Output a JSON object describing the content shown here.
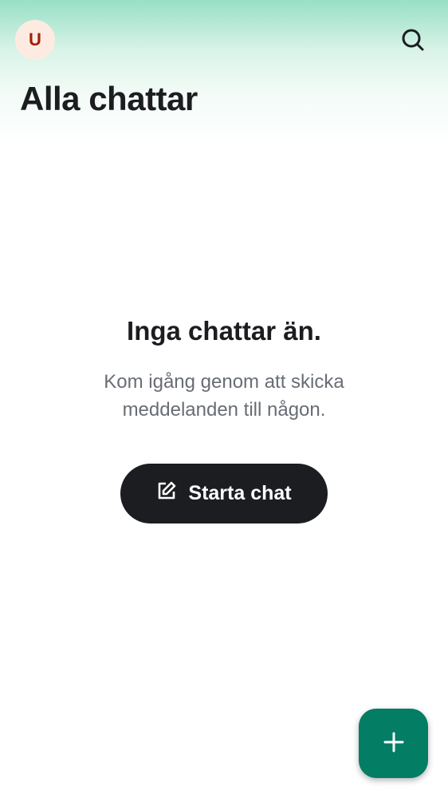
{
  "header": {
    "avatar_initial": "U",
    "title": "Alla chattar",
    "search_icon": "search-icon"
  },
  "empty_state": {
    "heading": "Inga chattar än.",
    "message": "Kom igång genom att skicka meddelanden till någon.",
    "button_label": "Starta chat",
    "button_icon": "edit-icon"
  },
  "fab": {
    "icon": "plus-icon"
  },
  "colors": {
    "accent": "#037d64",
    "avatar_bg": "#fdebe2",
    "avatar_text": "#a31f08",
    "button_bg": "#1c1d21"
  }
}
